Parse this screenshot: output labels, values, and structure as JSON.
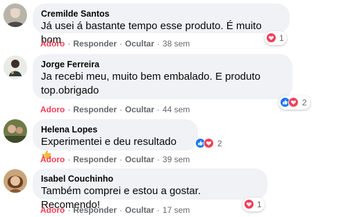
{
  "actions": {
    "love": "Adoro",
    "reply": "Responder",
    "hide": "Ocultar",
    "dot": "·"
  },
  "comments": [
    {
      "name": "Cremilde Santos",
      "text": "Já usei á bastante tempo esse produto. É muito bom",
      "time": "38 sem",
      "reaction_count": "1",
      "reactions": [
        "love-reaction-icon"
      ]
    },
    {
      "name": "Jorge Ferreira",
      "text_line1": "Ja recebi meu, muito bem embalado. E produto",
      "text_line2": "top.obrigado",
      "time": "44 sem",
      "reaction_count": "2",
      "reactions": [
        "like-reaction-icon",
        "love-reaction-icon"
      ]
    },
    {
      "name": "Helena Lopes",
      "text": "Experimentei e deu resultado",
      "time": "39 sem",
      "reaction_count": "2",
      "reactions": [
        "like-reaction-icon",
        "love-reaction-icon"
      ],
      "emoji": "thumbs-up-emoji"
    },
    {
      "name": "Isabel Couchinho",
      "text": "Também comprei e estou a gostar. Recomendo!",
      "time": "17 sem",
      "reaction_count": "1",
      "reactions": [
        "love-reaction-icon"
      ]
    }
  ],
  "colors": {
    "love": "#f33e58",
    "like": "#1877f2",
    "bubble": "#f0f2f5",
    "meta": "#65676b"
  }
}
